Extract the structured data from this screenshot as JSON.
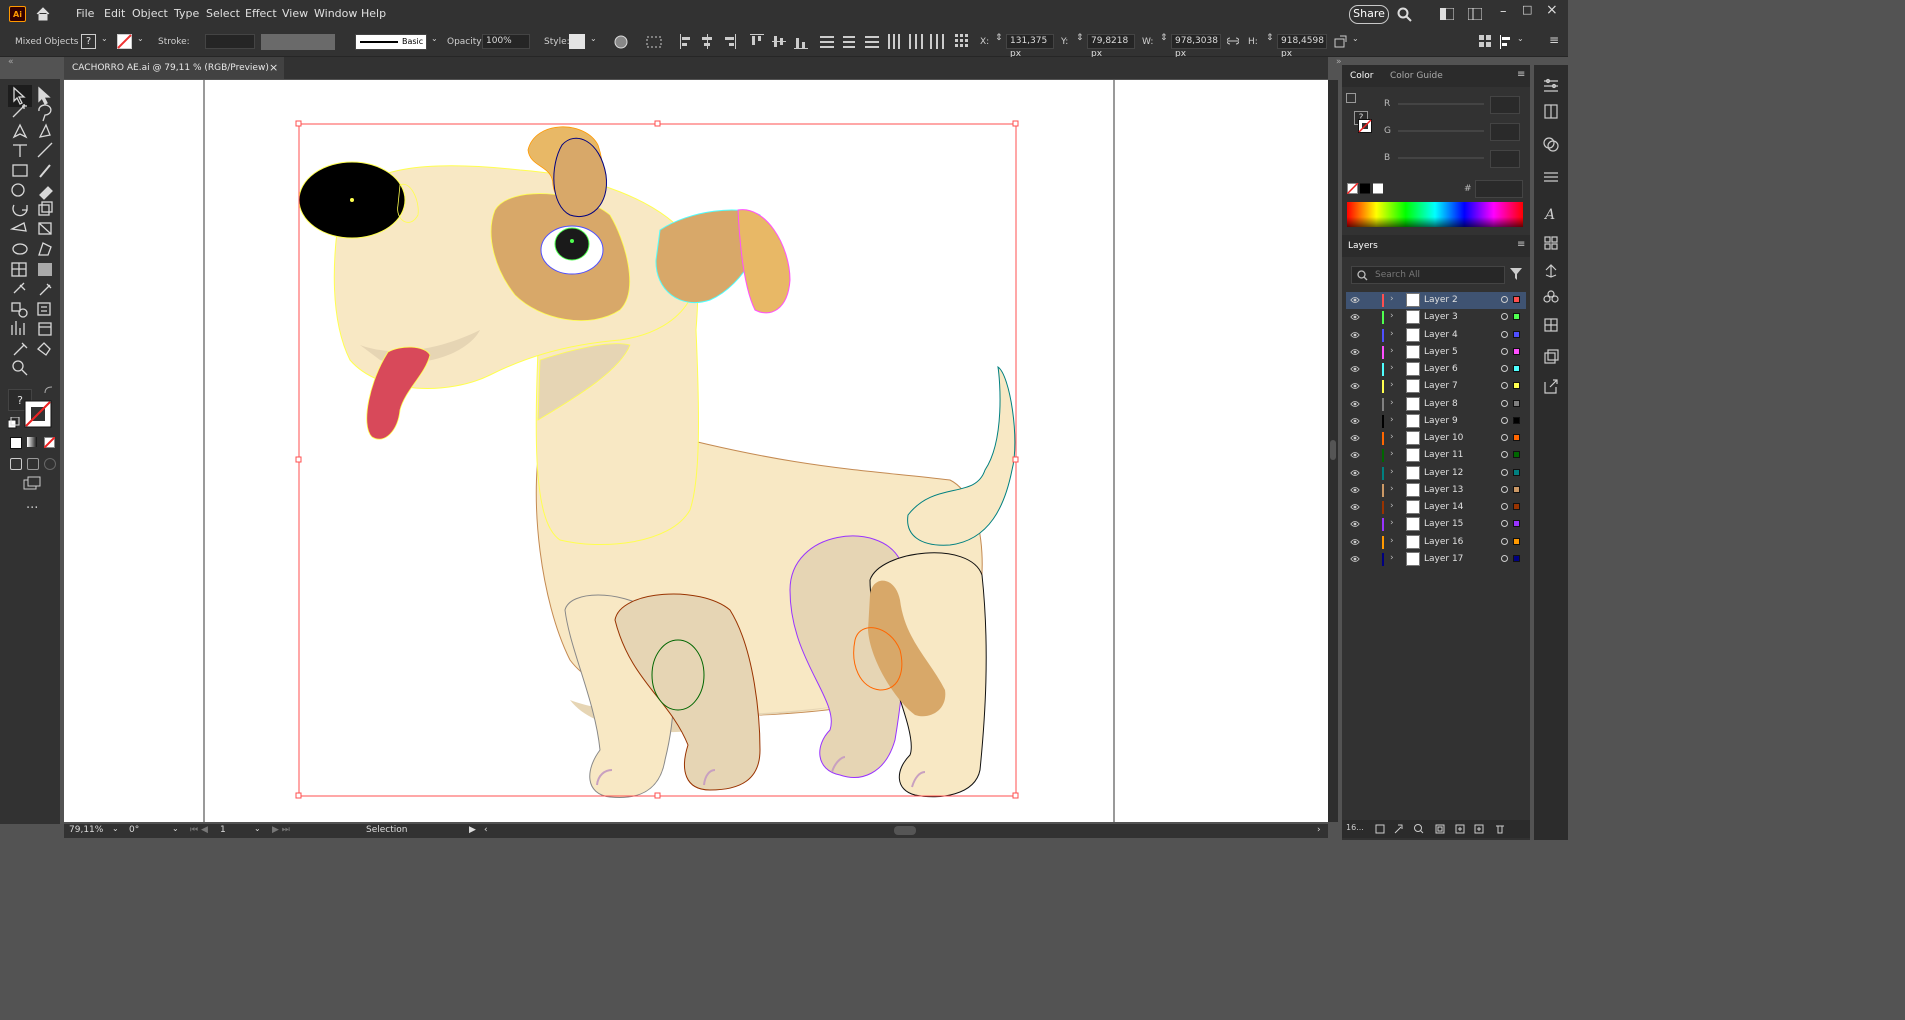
{
  "app": {
    "logo": "Ai"
  },
  "menu": [
    "File",
    "Edit",
    "Object",
    "Type",
    "Select",
    "Effect",
    "View",
    "Window",
    "Help"
  ],
  "share_label": "Share",
  "control": {
    "selection_type": "Mixed Objects",
    "stroke_label": "Stroke:",
    "brush_label": "Basic",
    "opacity_label": "Opacity:",
    "opacity_value": "100%",
    "style_label": "Style:",
    "x_label": "X:",
    "x_value": "131,375 px",
    "y_label": "Y:",
    "y_value": "79,8218 px",
    "w_label": "W:",
    "w_value": "978,3038 px",
    "h_label": "H:",
    "h_value": "918,4598 px"
  },
  "document": {
    "tab_title": "CACHORRO AE.ai @ 79,11 % (RGB/Preview)",
    "close_icon": "×"
  },
  "status": {
    "zoom": "79,11%",
    "rotation": "0°",
    "artboard": "1",
    "tool": "Selection"
  },
  "color_panel": {
    "tabs": [
      "Color",
      "Color Guide"
    ],
    "channels": [
      "R",
      "G",
      "B"
    ],
    "hex_label": "#"
  },
  "layers_panel": {
    "title": "Layers",
    "search_placeholder": "Search All",
    "count_label": "16...",
    "layers": [
      {
        "name": "Layer 2",
        "color": "#ff4f4f",
        "selected": true
      },
      {
        "name": "Layer 3",
        "color": "#4fff4f"
      },
      {
        "name": "Layer 4",
        "color": "#4f4fff"
      },
      {
        "name": "Layer 5",
        "color": "#ff4fff"
      },
      {
        "name": "Layer 6",
        "color": "#4fffff"
      },
      {
        "name": "Layer 7",
        "color": "#ffff4f"
      },
      {
        "name": "Layer 8",
        "color": "#808080"
      },
      {
        "name": "Layer 9",
        "color": "#000000"
      },
      {
        "name": "Layer 10",
        "color": "#ff6600"
      },
      {
        "name": "Layer 11",
        "color": "#006600"
      },
      {
        "name": "Layer 12",
        "color": "#008080"
      },
      {
        "name": "Layer 13",
        "color": "#cc9966"
      },
      {
        "name": "Layer 14",
        "color": "#993300"
      },
      {
        "name": "Layer 15",
        "color": "#9933ff"
      },
      {
        "name": "Layer 16",
        "color": "#ff9900"
      },
      {
        "name": "Layer 17",
        "color": "#000080"
      }
    ]
  }
}
